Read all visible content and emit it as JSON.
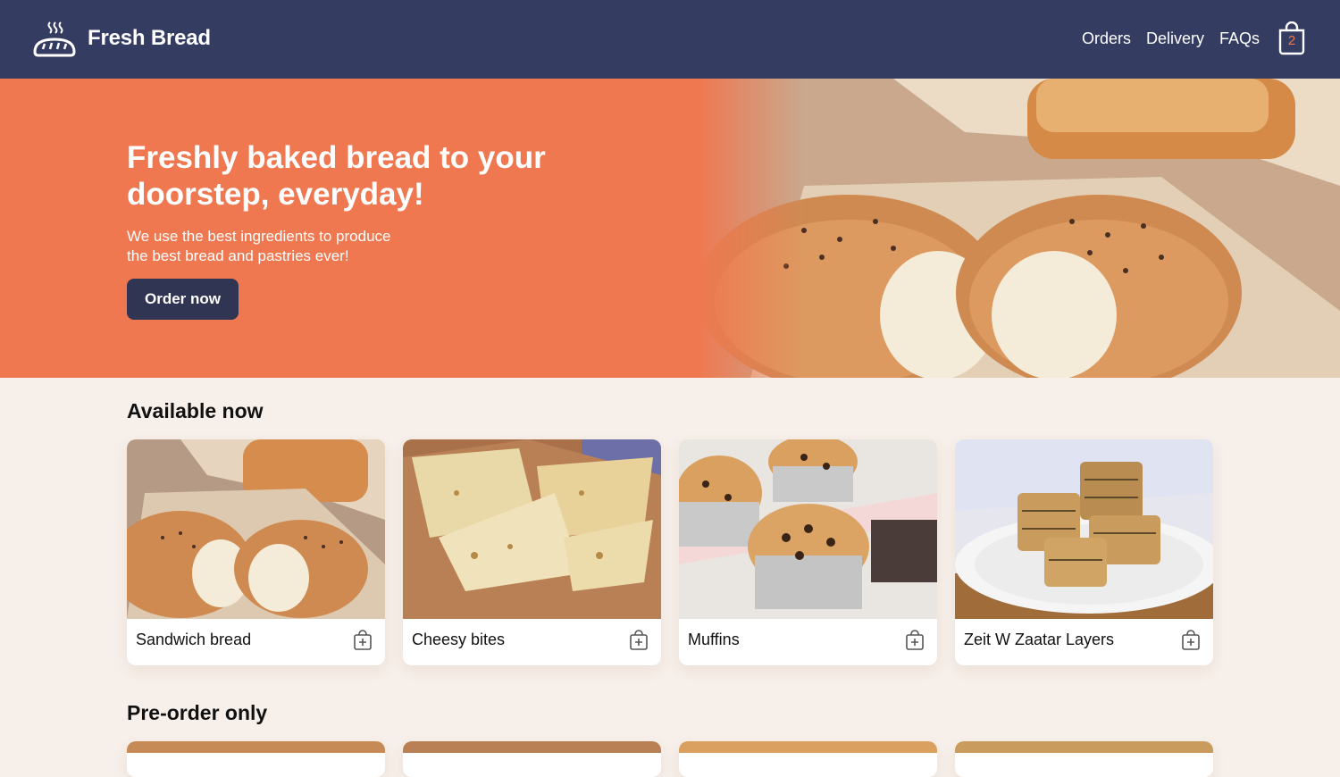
{
  "header": {
    "brand": "Fresh Bread",
    "nav": [
      "Orders",
      "Delivery",
      "FAQs"
    ],
    "cart_count": "2",
    "colors": {
      "header_bg": "#343c61",
      "accent": "#ef7850"
    }
  },
  "hero": {
    "title": "Freshly baked bread to your doorstep, everyday!",
    "subtitle_line1": "We use the best ingredients to produce",
    "subtitle_line2": "the best bread and pastries ever!",
    "cta": "Order now",
    "image": "sandwich-bread-photo"
  },
  "sections": {
    "available_title": "Available now",
    "preorder_title": "Pre-order only"
  },
  "available": [
    {
      "name": "Sandwich bread",
      "image": "sandwich-bread-photo"
    },
    {
      "name": "Cheesy bites",
      "image": "cheesy-bites-photo"
    },
    {
      "name": "Muffins",
      "image": "muffins-photo"
    },
    {
      "name": "Zeit W Zaatar Layers",
      "image": "zaatar-layers-photo"
    }
  ],
  "icons": {
    "logo": "bread-steam-icon",
    "cart": "shopping-bag-icon",
    "add": "add-to-bag-icon"
  }
}
